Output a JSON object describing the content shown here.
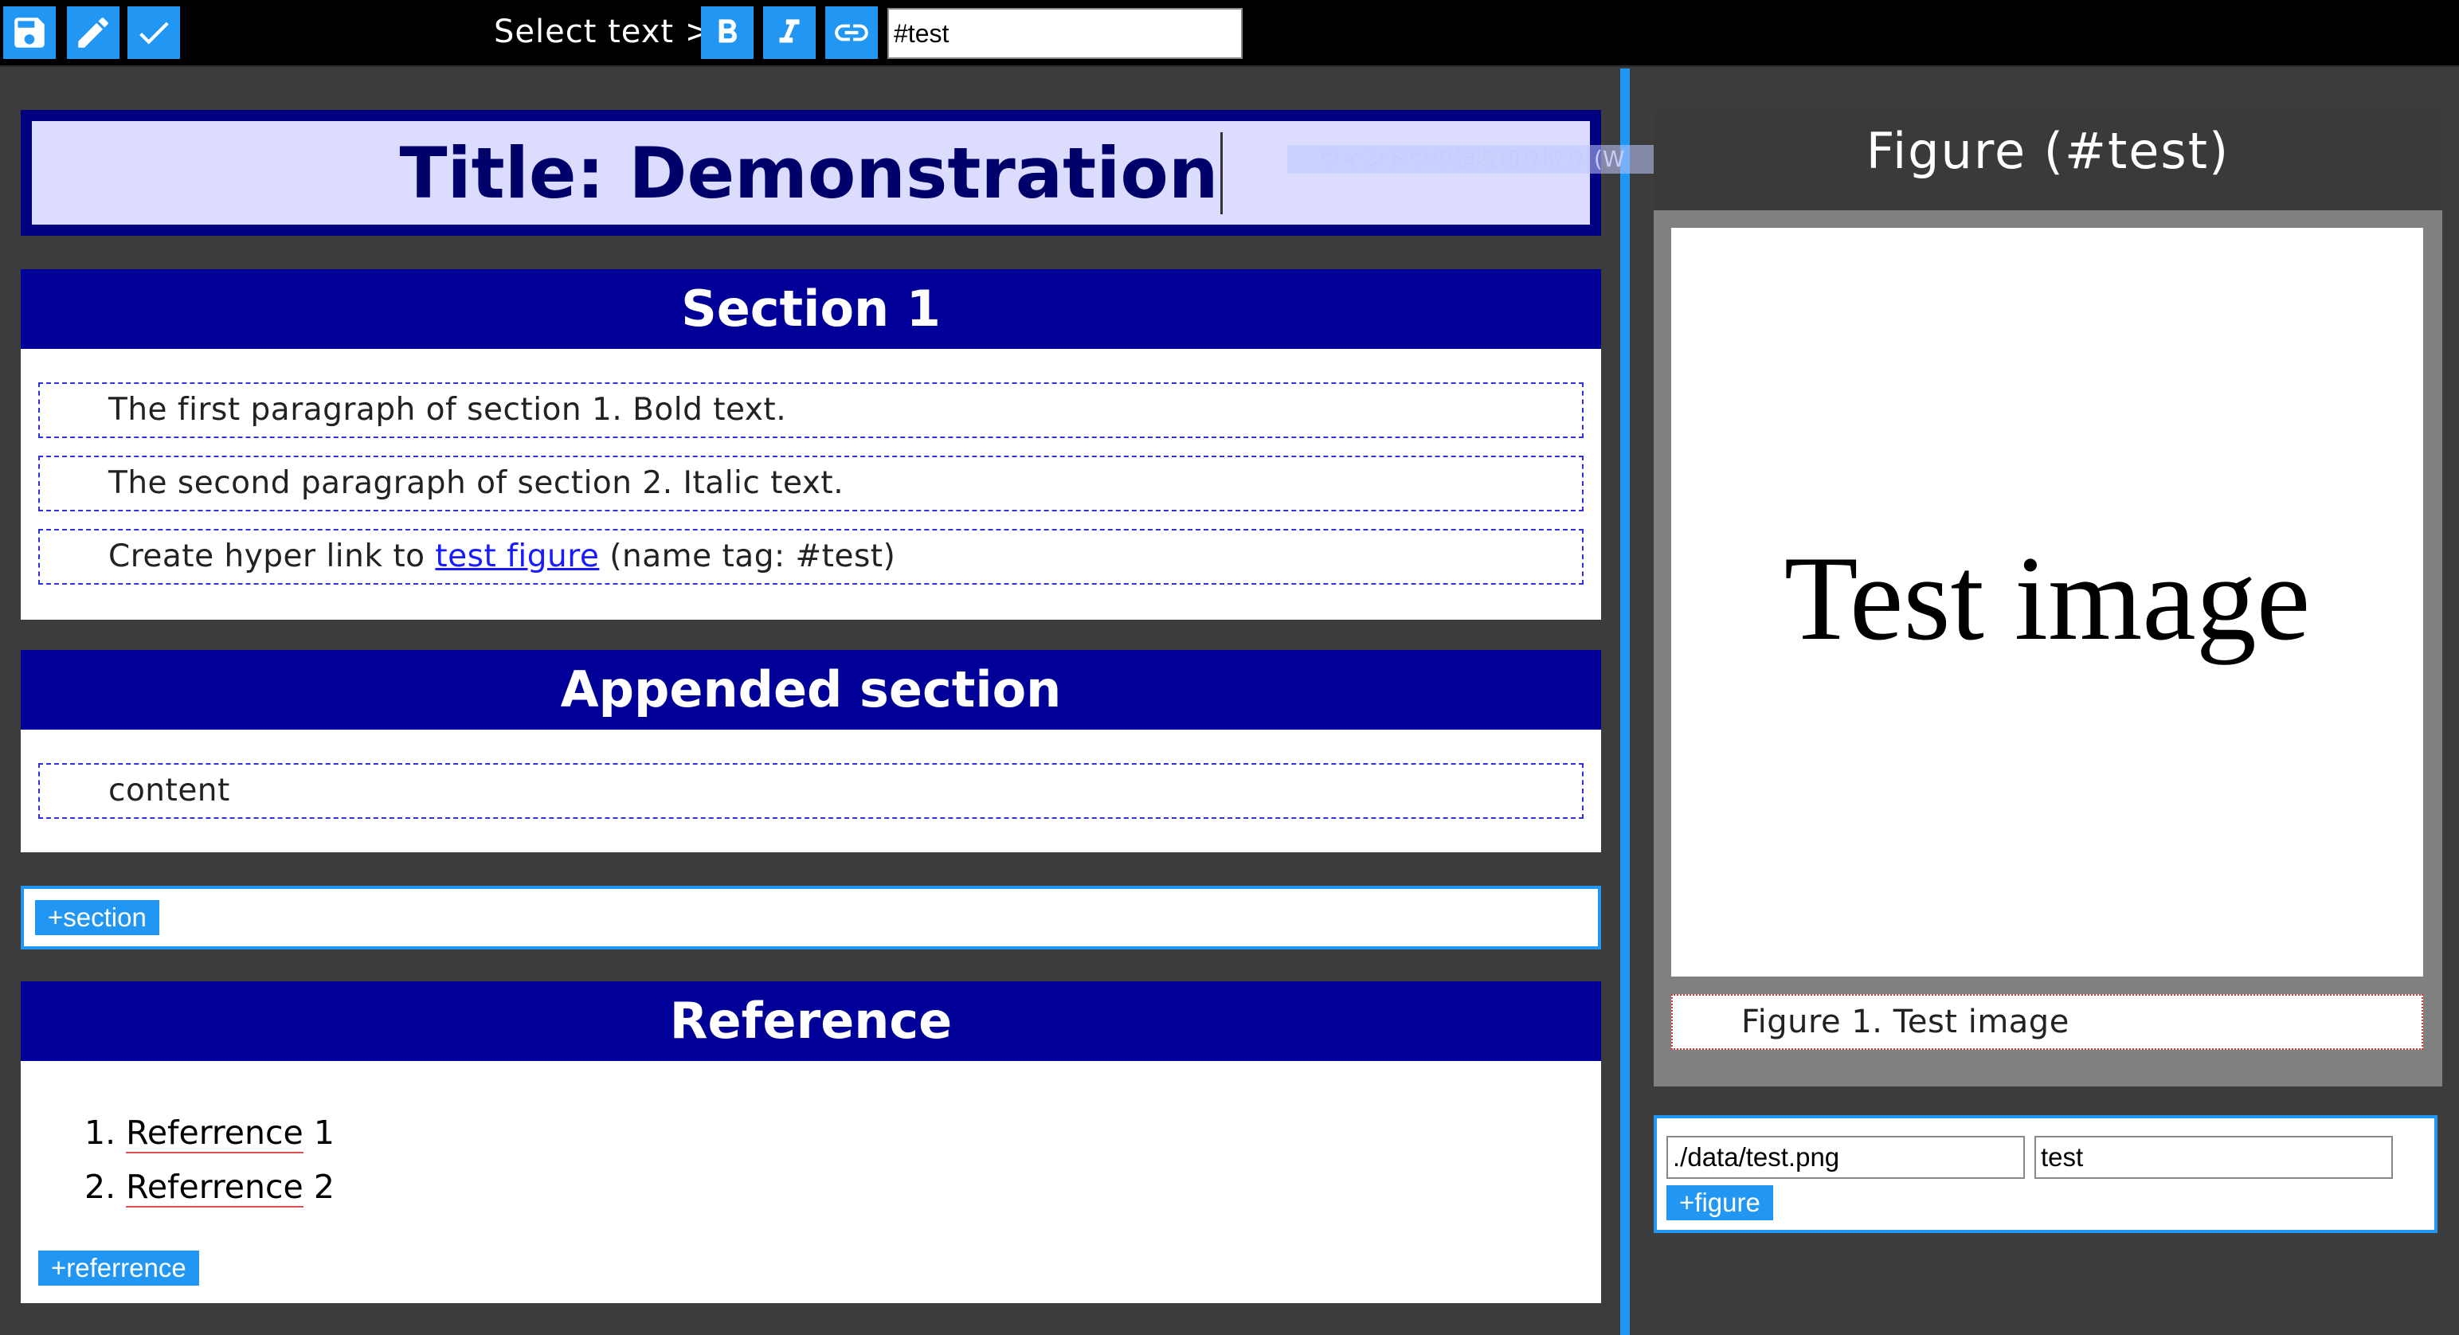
{
  "toolbar": {
    "save_icon": "save-icon",
    "edit_icon": "pencil-icon",
    "confirm_icon": "check-icon",
    "select_text_label": "Select text >",
    "bold_icon": "bold-icon",
    "italic_icon": "italic-icon",
    "link_icon": "link-icon",
    "tag_value": "#test"
  },
  "document": {
    "title": "Title: Demonstration",
    "overlay_tip": "ウィンドウの領域切り取り (W"
  },
  "sections": [
    {
      "heading": "Section 1",
      "paragraphs": [
        {
          "text": "The first paragraph of section 1. Bold text."
        },
        {
          "text": "The second paragraph of section 2. Italic text."
        },
        {
          "prefix": "Create hyper link to ",
          "link": "test figure",
          "suffix": " (name tag: #test)"
        }
      ]
    },
    {
      "heading": "Appended section",
      "paragraphs": [
        {
          "text": "content"
        }
      ]
    }
  ],
  "add_section_label": "+section",
  "reference": {
    "heading": "Reference",
    "items": [
      {
        "num": "1.",
        "name": "Referrence",
        "suffix": " 1"
      },
      {
        "num": "2.",
        "name": "Referrence",
        "suffix": " 2"
      }
    ],
    "add_label": "+referrence"
  },
  "figure_panel": {
    "title": "Figure (#test)",
    "image_text": "Test image",
    "caption": "Figure 1. Test image"
  },
  "figure_form": {
    "path_value": "./data/test.png",
    "name_value": "test",
    "add_label": "+figure"
  },
  "colors": {
    "accent": "#2196f3",
    "header_navy": "#000099",
    "title_bg": "#dcdcff",
    "link": "#1a1aff"
  }
}
